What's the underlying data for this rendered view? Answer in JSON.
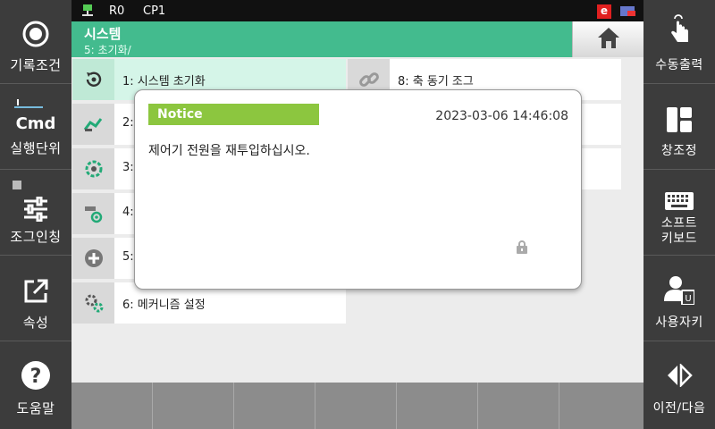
{
  "status": {
    "robot": "R0",
    "program": "CP1",
    "e_badge": "e"
  },
  "title": {
    "main": "시스템",
    "sub": "5: 초기화/"
  },
  "menu": [
    {
      "label": "1: 시스템 초기화"
    },
    {
      "label": "2:"
    },
    {
      "label": "3:"
    },
    {
      "label": "4:"
    },
    {
      "label": "5:"
    },
    {
      "label": "6: 메커니즘 설정"
    },
    {
      "label": "8: 축 동기 조그"
    }
  ],
  "left_sidebar": [
    {
      "label": "기록조건",
      "icon": "record-icon"
    },
    {
      "label": "실행단위",
      "icon": "cmd-icon",
      "icon_text": "Cmd"
    },
    {
      "label": "조그인칭",
      "icon": "sliders-icon"
    },
    {
      "label": "속성",
      "icon": "external-link-icon"
    },
    {
      "label": "도움말",
      "icon": "help-icon"
    }
  ],
  "right_sidebar": [
    {
      "label": "수동출력",
      "icon": "touch-hand-icon"
    },
    {
      "label": "창조정",
      "icon": "window-layout-icon"
    },
    {
      "label_line1": "소프트",
      "label_line2": "키보드",
      "icon": "keyboard-icon"
    },
    {
      "label": "사용자키",
      "icon": "user-key-icon"
    },
    {
      "label": "이전/다음",
      "icon": "prev-next-icon"
    }
  ],
  "dialog": {
    "title": "Notice",
    "timestamp": "2023-03-06  14:46:08",
    "message": "제어기 전원을 재투입하십시오."
  },
  "colors": {
    "accent": "#43bb8e",
    "notice": "#8cc63f",
    "sidebar": "#3c3c3c"
  }
}
